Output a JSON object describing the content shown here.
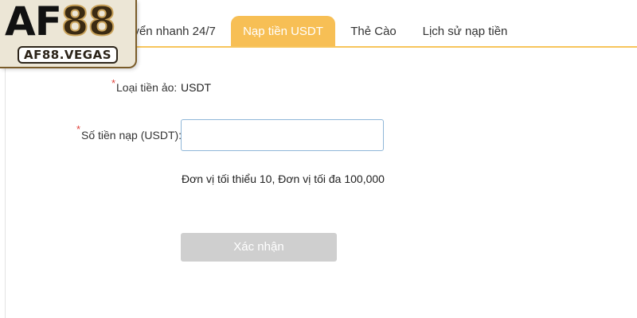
{
  "logo": {
    "mark_af": "AF",
    "mark_88": "88",
    "domain": "AF88.VEGAS"
  },
  "tabs": [
    {
      "label": "uyển nhanh 24/7",
      "active": false
    },
    {
      "label": "Nạp tiền USDT",
      "active": true
    },
    {
      "label": "Thẻ Cào",
      "active": false
    },
    {
      "label": "Lịch sử nạp tiền",
      "active": false
    }
  ],
  "colors": {
    "active_tab": "#f7bf55",
    "required_star": "#e0403a",
    "input_border": "#8fb6d8",
    "disabled_button": "#cfcfcf"
  },
  "form": {
    "currency": {
      "required_mark": "*",
      "label": "Loại tiền ảo:",
      "value": "USDT"
    },
    "amount": {
      "required_mark": "*",
      "label": "Số tiền nạp (USDT):",
      "value": "",
      "placeholder": ""
    },
    "hint": "Đơn vị tối thiểu 10, Đơn vị tối đa 100,000",
    "submit_label": "Xác nhận"
  }
}
